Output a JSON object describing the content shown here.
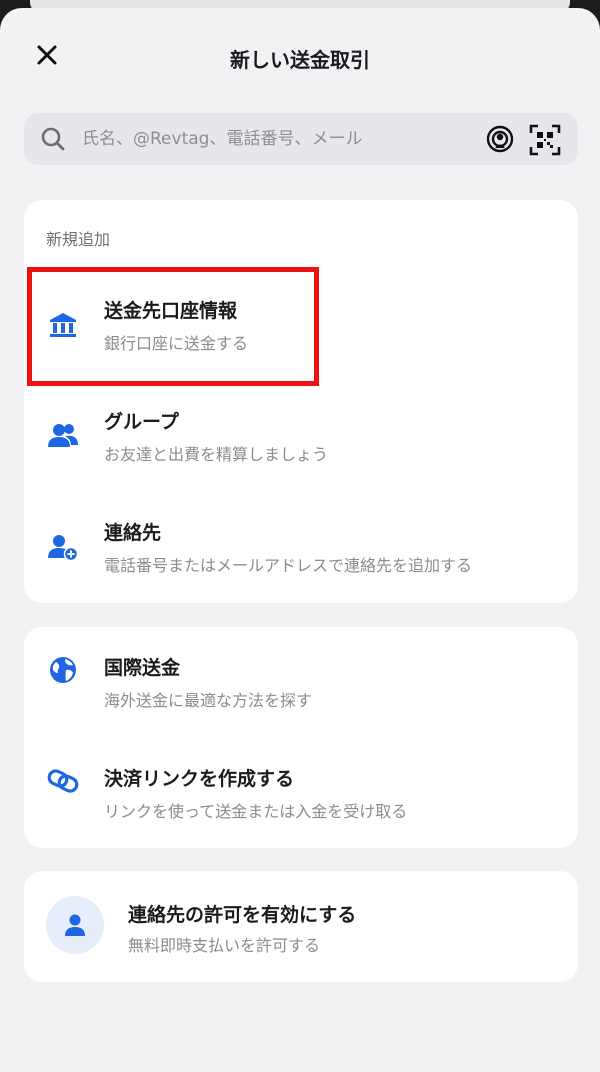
{
  "header": {
    "title": "新しい送金取引"
  },
  "search": {
    "placeholder": "氏名、@Revtag、電話番号、メール"
  },
  "new_section": {
    "label": "新規追加",
    "items": [
      {
        "title": "送金先口座情報",
        "subtitle": "銀行口座に送金する",
        "icon": "bank-icon"
      },
      {
        "title": "グループ",
        "subtitle": "お友達と出費を精算しましょう",
        "icon": "group-icon"
      },
      {
        "title": "連絡先",
        "subtitle": "電話番号またはメールアドレスで連絡先を追加する",
        "icon": "add-contact-icon"
      }
    ]
  },
  "transfer_section": {
    "items": [
      {
        "title": "国際送金",
        "subtitle": "海外送金に最適な方法を探す",
        "icon": "globe-icon"
      },
      {
        "title": "決済リンクを作成する",
        "subtitle": "リンクを使って送金または入金を受け取る",
        "icon": "link-icon"
      }
    ]
  },
  "permission": {
    "title": "連絡先の許可を有効にする",
    "subtitle": "無料即時支払いを許可する",
    "icon": "person-icon"
  },
  "colors": {
    "accent": "#1f66e5",
    "highlight": "#ee1111",
    "background": "#f2f2f5",
    "card": "#ffffff"
  }
}
